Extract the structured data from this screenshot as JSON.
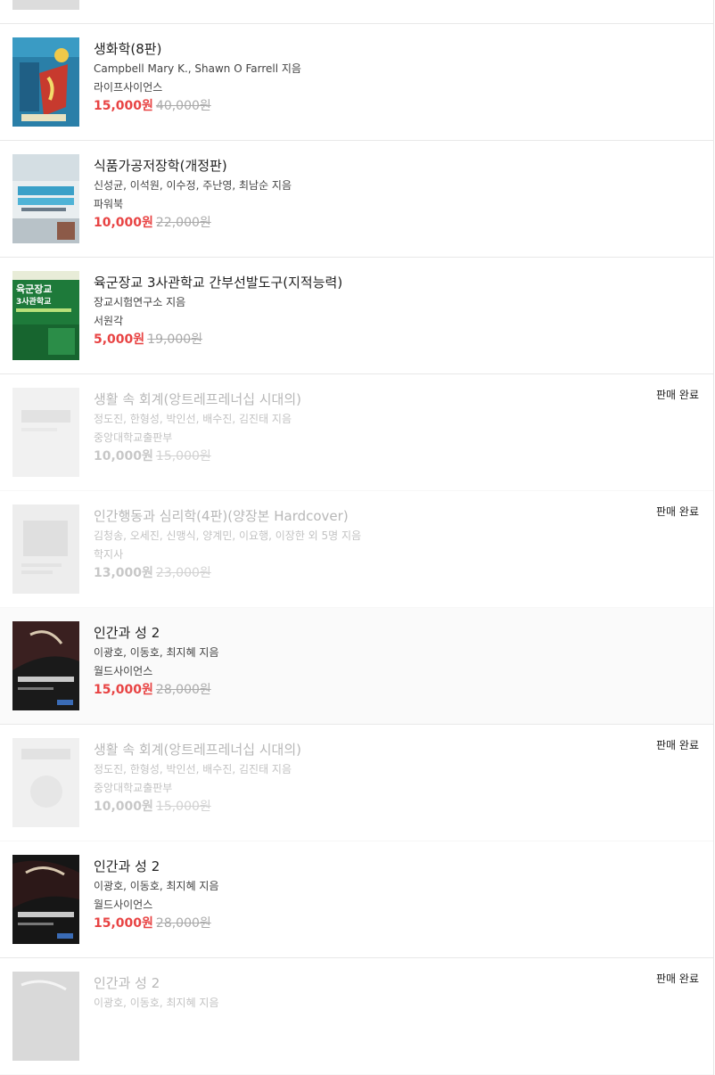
{
  "books": [
    {
      "title": "생화학(8판)",
      "author": "Campbell Mary K., Shawn O Farrell 지음",
      "publisher": "라이프사이언스",
      "price": "15,000원",
      "original_price": "40,000원",
      "status": "",
      "thumb_icon": "biochemistry-cover-icon"
    },
    {
      "title": "식품가공저장학(개정판)",
      "author": "신성균, 이석원, 이수정, 주난영, 최남순 지음",
      "publisher": "파워북",
      "price": "10,000원",
      "original_price": "22,000원",
      "status": "",
      "thumb_icon": "food-processing-cover-icon"
    },
    {
      "title": "육군장교 3사관학교 간부선발도구(지적능력)",
      "author": "장교시험연구소 지음",
      "publisher": "서원각",
      "price": "5,000원",
      "original_price": "19,000원",
      "status": "",
      "thumb_icon": "army-officer-cover-icon",
      "cover_text": [
        "육군장교",
        "3사관학교"
      ]
    },
    {
      "title": "생활 속 회계(앙트레프레너십 시대의)",
      "author": "정도진, 한형성, 박인선, 배수진, 김진태 지음",
      "publisher": "중앙대학교출판부",
      "price": "10,000원",
      "original_price": "15,000원",
      "status": "판매 완료",
      "thumb_icon": "accounting-cover-icon"
    },
    {
      "title": "인간행동과 심리학(4판)(양장본 Hardcover)",
      "author": "김청송, 오세진, 신맹식, 양계민, 이요행, 이장한 외 5명 지음",
      "publisher": "학지사",
      "price": "13,000원",
      "original_price": "23,000원",
      "status": "판매 완료",
      "thumb_icon": "psychology-cover-icon"
    },
    {
      "title": "인간과 성 2",
      "author": "이광호, 이동호, 최지혜 지음",
      "publisher": "월드사이언스",
      "price": "15,000원",
      "original_price": "28,000원",
      "status": "",
      "thumb_icon": "human-sexuality-cover-icon"
    },
    {
      "title": "생활 속 회계(앙트레프레너십 시대의)",
      "author": "정도진, 한형성, 박인선, 배수진, 김진태 지음",
      "publisher": "중앙대학교출판부",
      "price": "10,000원",
      "original_price": "15,000원",
      "status": "판매 완료",
      "thumb_icon": "accounting-cover-icon"
    },
    {
      "title": "인간과 성 2",
      "author": "이광호, 이동호, 최지혜 지음",
      "publisher": "월드사이언스",
      "price": "15,000원",
      "original_price": "28,000원",
      "status": "",
      "thumb_icon": "human-sexuality-cover-icon"
    },
    {
      "title": "인간과 성 2",
      "author": "이광호, 이동호, 최지혜 지음",
      "publisher": "",
      "price": "",
      "original_price": "",
      "status": "판매 완료",
      "thumb_icon": "human-sexuality-cover-icon"
    }
  ],
  "colors": {
    "price": "#e84343",
    "divider": "#e8e8e8",
    "alt_row": "#fafafa"
  }
}
